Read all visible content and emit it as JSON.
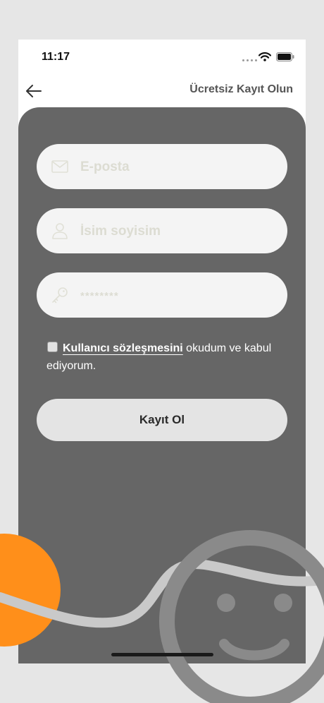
{
  "status_bar": {
    "time": "11:17"
  },
  "nav": {
    "title": "Ücretsiz Kayıt Olun",
    "back_icon": "arrow-left-icon"
  },
  "form": {
    "email": {
      "placeholder": "E-posta",
      "value": "",
      "icon": "mail-icon"
    },
    "name": {
      "placeholder": "İsim soyisim",
      "value": "",
      "icon": "user-icon"
    },
    "password": {
      "placeholder": "********",
      "value": "",
      "icon": "key-icon"
    },
    "agreement": {
      "checked": false,
      "link_text": "Kullanıcı sözleşmesini",
      "rest_text": " okudum ve kabul ediyorum."
    },
    "submit_label": "Kayıt Ol"
  },
  "colors": {
    "panel": "#666666",
    "input_bg": "#f4f4f4",
    "button_bg": "#e4e4e4",
    "accent_orange": "#ff8f1a",
    "decor_gray": "#8a8a8a"
  }
}
